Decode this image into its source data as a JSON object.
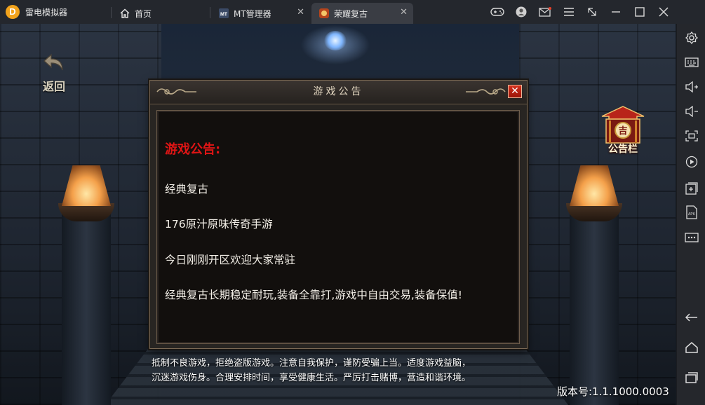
{
  "emulator": {
    "app_name": "雷电模拟器",
    "tabs": [
      {
        "label": "首页",
        "icon": "home-icon"
      },
      {
        "label": "MT管理器",
        "icon": "mt-app-icon"
      },
      {
        "label": "荣耀复古",
        "icon": "game-app-icon"
      }
    ],
    "window_controls": [
      "gamepad-icon",
      "avatar-icon",
      "mail-icon",
      "menu-icon",
      "resize-icon",
      "minimize-icon",
      "maximize-icon",
      "close-icon"
    ],
    "sidebar": [
      "settings-icon",
      "keyboard-icon",
      "volume-up-icon",
      "volume-down-icon",
      "screenshot-icon",
      "record-icon",
      "add-app-icon",
      "apk-install-icon",
      "more-icon",
      "back-icon",
      "home-icon",
      "recent-apps-icon"
    ]
  },
  "game": {
    "back_label": "返回",
    "notice_button_label": "公告栏",
    "notice_button_glyph": "吉",
    "dialog": {
      "title": "游戏公告",
      "close_glyph": "✕",
      "heading": "游戏公告:",
      "lines": [
        "经典复古",
        "176原汁原味传奇手游",
        "今日刚刚开区欢迎大家常驻",
        "经典复古长期稳定耐玩,装备全靠打,游戏中自由交易,装备保值!"
      ]
    },
    "health_advisory": [
      "抵制不良游戏，拒绝盗版游戏。注意自我保护，谨防受骗上当。适度游戏益脑，",
      "沉迷游戏伤身。合理安排时间，享受健康生活。严厉打击赌博，营造和谐环境。"
    ],
    "version": "版本号:1.1.1000.0003"
  }
}
